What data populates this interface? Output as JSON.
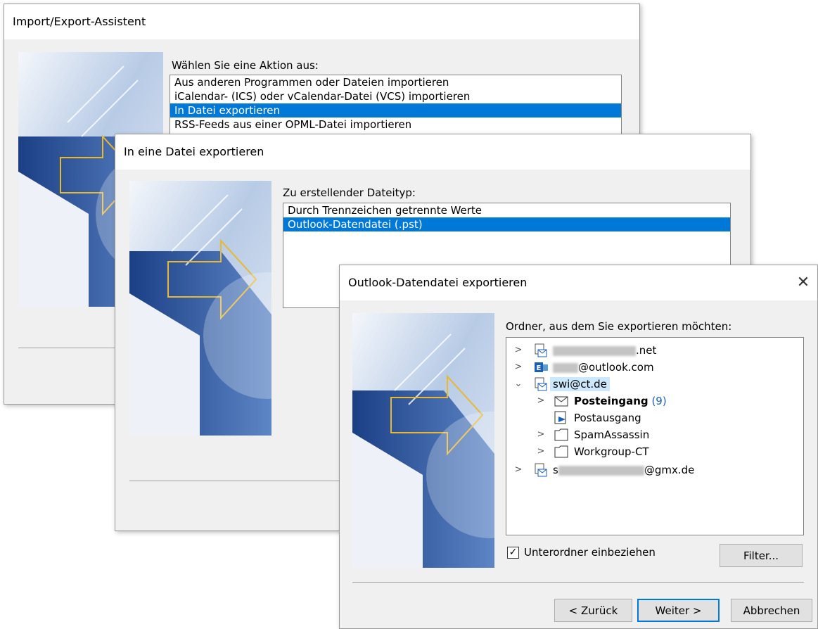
{
  "dialog1": {
    "title": "Import/Export-Assistent",
    "prompt": "Wählen Sie eine Aktion aus:",
    "actions": [
      {
        "label": "Aus anderen Programmen oder Dateien importieren",
        "selected": false
      },
      {
        "label": "iCalendar- (ICS) oder vCalendar-Datei (VCS) importieren",
        "selected": false
      },
      {
        "label": "In Datei exportieren",
        "selected": true
      },
      {
        "label": "RSS-Feeds aus einer OPML-Datei importieren",
        "selected": false
      }
    ]
  },
  "dialog2": {
    "title": "In eine Datei exportieren",
    "prompt": "Zu erstellender Dateityp:",
    "filetypes": [
      {
        "label": "Durch Trennzeichen getrennte Werte",
        "selected": false
      },
      {
        "label": "Outlook-Datendatei (.pst)",
        "selected": true
      }
    ]
  },
  "dialog3": {
    "title": "Outlook-Datendatei exportieren",
    "close_icon": "close-icon",
    "prompt": "Ordner, aus dem Sie exportieren möchten:",
    "tree": {
      "account1_suffix": ".net",
      "account2_suffix": "@outlook.com",
      "account3_label": "swi@ct.de",
      "inbox_label": "Posteingang",
      "inbox_count": "(9)",
      "outbox_label": "Postausgang",
      "spam_label": "SpamAssassin",
      "workgroup_label": "Workgroup-CT",
      "account4_prefix": "s",
      "account4_suffix": "@gmx.de"
    },
    "include_subfolders_label": "Unterordner einbeziehen",
    "include_subfolders_checked": true,
    "filter_button": "Filter...",
    "back_button": "< Zurück",
    "next_button": "Weiter >",
    "cancel_button": "Abbrechen"
  },
  "colors": {
    "selection": "#0078d7",
    "dialog_bg": "#f0f0f0",
    "accent_blue": "#1a4f9c",
    "arrow_gold": "#e8b830"
  }
}
